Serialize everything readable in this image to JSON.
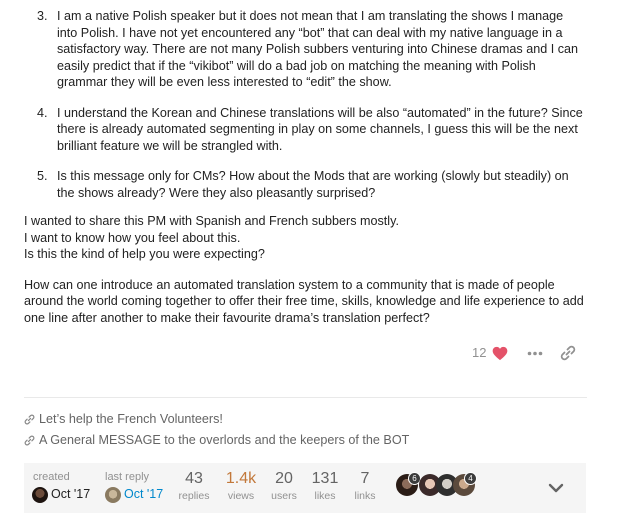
{
  "post": {
    "points": [
      {
        "num": "3.",
        "text": "I am a native Polish speaker but it does not mean that I am translating the shows I manage into Polish. I have not yet encountered any “bot” that can deal with my native language in a satisfactory way. There are not many Polish subbers venturing into Chinese dramas and I can easily predict that if the “vikibot” will do a bad job on matching the meaning with Polish grammar they will be even less interested to “edit” the show."
      },
      {
        "num": "4.",
        "text": "I understand the Korean and Chinese translations will be also “automated” in the future? Since there is already automated segmenting in play on some channels, I guess this will be the next brilliant feature we will be strangled with."
      },
      {
        "num": "5.",
        "text": "Is this message only for CMs? How about the Mods that are working (slowly but steadily) on the shows already? Were they also pleasantly surprised?"
      }
    ],
    "para1": {
      "line1": "I wanted to share this PM with Spanish and French subbers mostly.",
      "line2": "I want to know how you feel about this.",
      "line3": "Is this the kind of help you were expecting?"
    },
    "para2": "How can one introduce an automated translation system to a community that is made of people around the world coming together to offer their free time, skills, knowledge and life experience to add one line after another to make their favourite drama’s translation perfect?",
    "likes_count": "12"
  },
  "links": [
    {
      "text": "Let’s help the French Volunteers!"
    },
    {
      "text": "A General MESSAGE to the overlords and the keepers of the BOT"
    }
  ],
  "summary": {
    "created_label": "created",
    "created_date": "Oct '17",
    "last_reply_label": "last reply",
    "last_reply_date": "Oct '17",
    "stats": [
      {
        "num": "43",
        "label": "replies"
      },
      {
        "num": "1.4k",
        "label": "views",
        "highlight": "#c2783a"
      },
      {
        "num": "20",
        "label": "users"
      },
      {
        "num": "131",
        "label": "likes"
      },
      {
        "num": "7",
        "label": "links"
      }
    ],
    "participant_badges": [
      "6",
      "4"
    ]
  },
  "colors": {
    "heart": "#e45269",
    "link_blue": "#0088cc",
    "muted": "#919191"
  },
  "icons": [
    "heart-icon",
    "more-icon",
    "share-link-icon",
    "link-icon",
    "chevron-down-icon"
  ]
}
